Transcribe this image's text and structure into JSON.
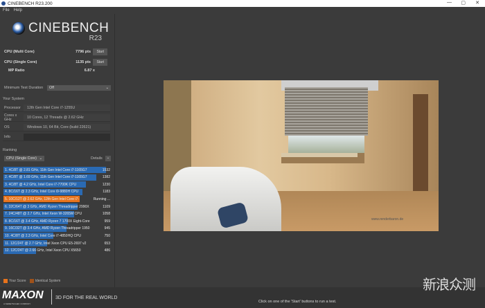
{
  "window": {
    "title": "CINEBENCH R23.200"
  },
  "menu": [
    "File",
    "Help"
  ],
  "logo": {
    "name": "CINEBENCH",
    "version": "R23"
  },
  "scores": {
    "multi": {
      "label": "CPU (Multi Core)",
      "value": "7796 pts",
      "button": "Start"
    },
    "single": {
      "label": "CPU (Single Core)",
      "value": "1135 pts",
      "button": "Start"
    },
    "mp": {
      "label": "MP Ratio",
      "value": "6.87 x"
    }
  },
  "min_duration": {
    "label": "Minimum Test Duration",
    "value": "Off"
  },
  "system": {
    "title": "Your System",
    "rows": [
      {
        "k": "Processor",
        "v": "12th Gen Intel Core i7-1255U"
      },
      {
        "k": "Cores x GHz",
        "v": "10 Cores, 12 Threads @ 2.62 GHz"
      },
      {
        "k": "OS",
        "v": "Windows 10, 64 Bit, Core (build 22621)"
      },
      {
        "k": "Info",
        "v": ""
      }
    ]
  },
  "ranking": {
    "title": "Ranking",
    "mode": "CPU (Single Core)",
    "details": "Details",
    "max": 1532,
    "items": [
      {
        "t": "1. 4C/8T @ 2.81 GHz, 11th Gen Intel Core i7-1165G7",
        "s": "1532",
        "n": 1532
      },
      {
        "t": "2. 4C/8T @ 1.69 GHz, 11th Gen Intel Core i7-1165G7",
        "s": "1382",
        "n": 1382
      },
      {
        "t": "3. 4C/8T @ 4.2 GHz, Intel Core i7-7700K CPU",
        "s": "1230",
        "n": 1230
      },
      {
        "t": "4. 8C/16T @ 2.3 GHz, Intel Core i9-9880H CPU",
        "s": "1183",
        "n": 1183
      },
      {
        "t": "5. 10C/12T @ 2.62 GHz, 12th Gen Intel Core i7-",
        "s": "Running ...",
        "n": 1135,
        "own": true
      },
      {
        "t": "6. 32C/64T @ 3 GHz, AMD Ryzen Threadripper 2990X",
        "s": "1109",
        "n": 1109
      },
      {
        "t": "7. 24C/48T @ 2.7 GHz, Intel Xeon W-3265M CPU",
        "s": "1058",
        "n": 1058
      },
      {
        "t": "8. 8C/16T @ 3.4 GHz, AMD Ryzen 7 1700X Eight-Core",
        "s": "959",
        "n": 959
      },
      {
        "t": "9. 16C/32T @ 3.4 GHz, AMD Ryzen Threadripper 1950",
        "s": "945",
        "n": 945
      },
      {
        "t": "10. 4C/8T @ 2.3 GHz, Intel Core i7-4850HQ CPU",
        "s": "750",
        "n": 750
      },
      {
        "t": "11. 12C/24T @ 2.7 GHz, Intel Xeon CPU E5-2697 v2",
        "s": "653",
        "n": 653
      },
      {
        "t": "12. 12C/24T @ 2.66 GHz, Intel Xeon CPU X5650",
        "s": "486",
        "n": 486
      }
    ]
  },
  "legend": {
    "your": "Your Score",
    "identical": "Identical System",
    "colors": {
      "your": "#e8731c",
      "identical": "#a0521a",
      "bar": "#2a6ab3"
    }
  },
  "footer": {
    "brand": "MAXON",
    "sub": "A NEMETSCHEK COMPANY",
    "tagline": "3D FOR THE REAL WORLD",
    "status": "Click on one of the 'Start' buttons to run a test.",
    "watermark": "新浪众测"
  },
  "render": {
    "watermark": "www.renderbaron.de"
  }
}
